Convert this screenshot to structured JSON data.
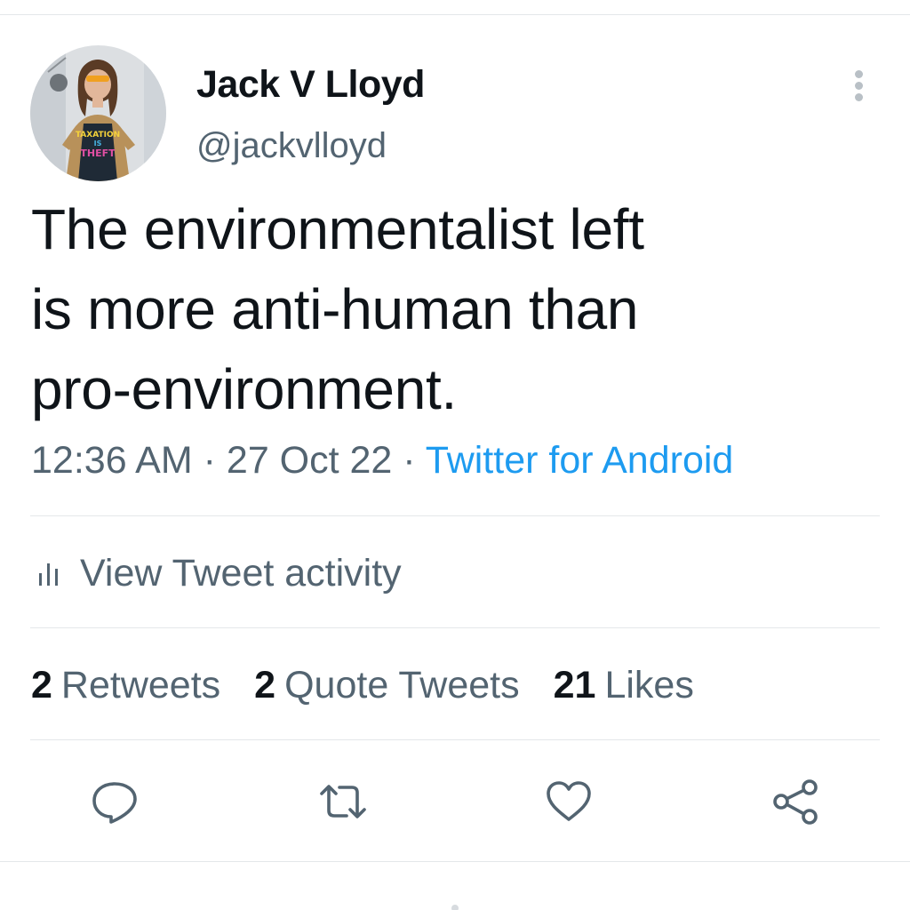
{
  "tweet": {
    "author": {
      "display_name": "Jack V Lloyd",
      "handle": "@jackvlloyd",
      "avatar_shirt_text": [
        "TAXATION",
        "IS",
        "THEFT"
      ]
    },
    "text_lines": [
      "The environmentalist left",
      "is more anti-human than",
      "pro-environment."
    ],
    "meta": {
      "time": "12:36 AM",
      "separator": " · ",
      "date": "27 Oct 22",
      "source": "Twitter for Android"
    },
    "activity_label": "View Tweet activity",
    "stats": [
      {
        "count": "2",
        "label": "Retweets"
      },
      {
        "count": "2",
        "label": "Quote Tweets"
      },
      {
        "count": "21",
        "label": "Likes"
      }
    ],
    "actions": [
      "reply-icon",
      "retweet-icon",
      "like-icon",
      "share-icon"
    ]
  },
  "colors": {
    "text_primary": "#0f1419",
    "text_secondary": "#536471",
    "link": "#1d9bf0",
    "divider": "#e4e7ea"
  }
}
